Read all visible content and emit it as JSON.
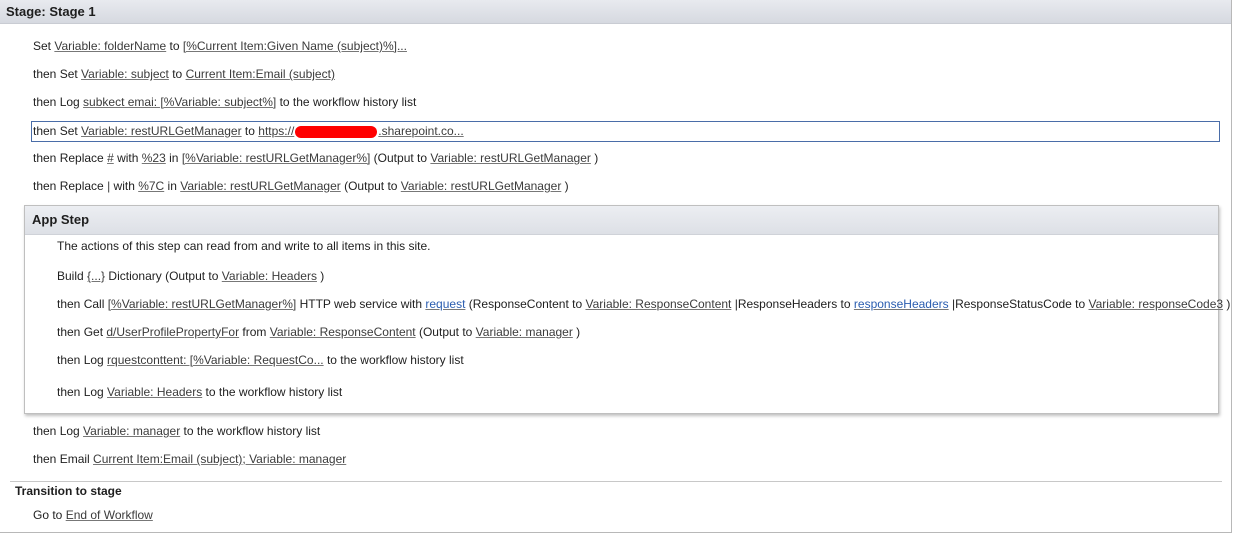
{
  "stage_title": "Stage: Stage 1",
  "stage_lines": [
    [
      {
        "t": "Set "
      },
      {
        "l": "Variable: folderName"
      },
      {
        "t": " to "
      },
      {
        "l": "[%Current Item:Given Name (subject)%]..."
      }
    ],
    [
      {
        "t": "then Set "
      },
      {
        "l": "Variable: subject"
      },
      {
        "t": " to "
      },
      {
        "l": "Current Item:Email (subject)"
      }
    ],
    [
      {
        "t": "then Log "
      },
      {
        "l": "subkect emai: [%Variable: subject%]"
      },
      {
        "t": " to the workflow history list"
      }
    ],
    [
      {
        "t": "then Set "
      },
      {
        "l": "Variable: restURLGetManager"
      },
      {
        "t": " to "
      },
      {
        "l": "https://"
      },
      {
        "r": "redacted"
      },
      {
        "l": ".sharepoint.co..."
      }
    ],
    [
      {
        "t": "then Replace "
      },
      {
        "l": "#"
      },
      {
        "t": " with "
      },
      {
        "l": "%23"
      },
      {
        "t": " in "
      },
      {
        "l": "[%Variable: restURLGetManager%]"
      },
      {
        "t": " (Output to "
      },
      {
        "l": "Variable: restURLGetManager"
      },
      {
        "t": " )"
      }
    ],
    [
      {
        "t": "then Replace "
      },
      {
        "l": "|"
      },
      {
        "t": " with "
      },
      {
        "l": "%7C"
      },
      {
        "t": " in "
      },
      {
        "l": "Variable: restURLGetManager"
      },
      {
        "t": " (Output to "
      },
      {
        "l": "Variable: restURLGetManager"
      },
      {
        "t": " )"
      }
    ]
  ],
  "app_step": {
    "title": "App Step",
    "description": "The actions of this step can read from and write to all items in this site.",
    "lines": [
      [
        {
          "t": "Build "
        },
        {
          "l": "{...}"
        },
        {
          "t": " Dictionary (Output to "
        },
        {
          "l": "Variable: Headers"
        },
        {
          "t": " )"
        }
      ],
      [
        {
          "t": "then Call "
        },
        {
          "l": "[%Variable: restURLGetManager%]"
        },
        {
          "t": " HTTP web service with "
        },
        {
          "b": "request"
        },
        {
          "t": " (ResponseContent to "
        },
        {
          "l": "Variable: ResponseContent"
        },
        {
          "t": " |ResponseHeaders to "
        },
        {
          "b": "responseHeaders"
        },
        {
          "t": " |ResponseStatusCode to "
        },
        {
          "l": "Variable: responseCode3"
        },
        {
          "t": " )"
        }
      ],
      [
        {
          "t": "then Get "
        },
        {
          "l": "d/UserProfilePropertyFor"
        },
        {
          "t": " from "
        },
        {
          "l": "Variable: ResponseContent"
        },
        {
          "t": " (Output to "
        },
        {
          "l": "Variable: manager"
        },
        {
          "t": " )"
        }
      ],
      [
        {
          "t": "then Log "
        },
        {
          "l": "rquestconttent: [%Variable: RequestCo..."
        },
        {
          "t": " to the workflow history list"
        }
      ],
      [
        {
          "t": "then Log "
        },
        {
          "l": "Variable: Headers"
        },
        {
          "t": " to the workflow history list"
        }
      ]
    ]
  },
  "after_lines": [
    [
      {
        "t": "then Log "
      },
      {
        "l": "Variable: manager"
      },
      {
        "t": " to the workflow history list"
      }
    ],
    [
      {
        "t": "then Email "
      },
      {
        "l": "Current Item:Email (subject); Variable: manager"
      }
    ]
  ],
  "transition": {
    "title": "Transition to stage",
    "line": [
      {
        "t": "Go to "
      },
      {
        "l": "End of Workflow"
      }
    ]
  }
}
